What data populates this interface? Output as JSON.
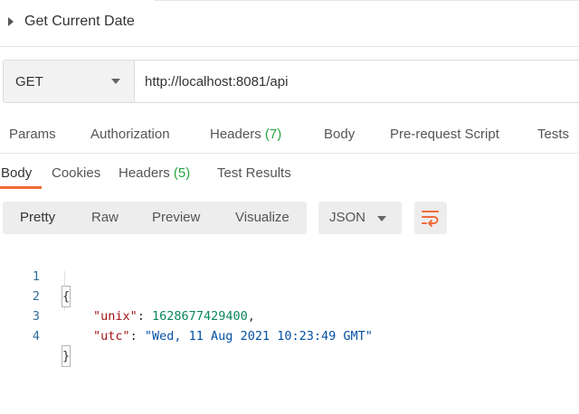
{
  "request": {
    "title": "Get Current Date",
    "method": "GET",
    "url": "http://localhost:8081/api"
  },
  "request_tabs": {
    "params": "Params",
    "authorization": "Authorization",
    "headers": "Headers",
    "headers_count": "(7)",
    "body": "Body",
    "pre_request": "Pre-request Script",
    "tests": "Tests"
  },
  "response_tabs": {
    "body": "Body",
    "cookies": "Cookies",
    "headers": "Headers",
    "headers_count": "(5)",
    "test_results": "Test Results"
  },
  "format": {
    "pretty": "Pretty",
    "raw": "Raw",
    "preview": "Preview",
    "visualize": "Visualize",
    "language": "JSON"
  },
  "code": {
    "line_numbers": [
      "1",
      "2",
      "3",
      "4"
    ],
    "open_brace": "{",
    "close_brace": "}",
    "unix_key": "\"unix\"",
    "unix_value": "1628677429400",
    "utc_key": "\"utc\"",
    "utc_value": "\"Wed, 11 Aug 2021 10:23:49 GMT\"",
    "colon": ": ",
    "comma": ","
  },
  "colors": {
    "accent": "#f26b3a",
    "count_green": "#26a53f",
    "json_key": "#a31515",
    "json_number": "#098658",
    "json_string": "#0451a5",
    "line_number": "#2f6e9c"
  },
  "icons": {
    "title_toggle": "caret-right-icon",
    "method_dropdown": "chevron-down-icon",
    "language_dropdown": "chevron-down-icon",
    "wrap": "wrap-lines-icon"
  }
}
